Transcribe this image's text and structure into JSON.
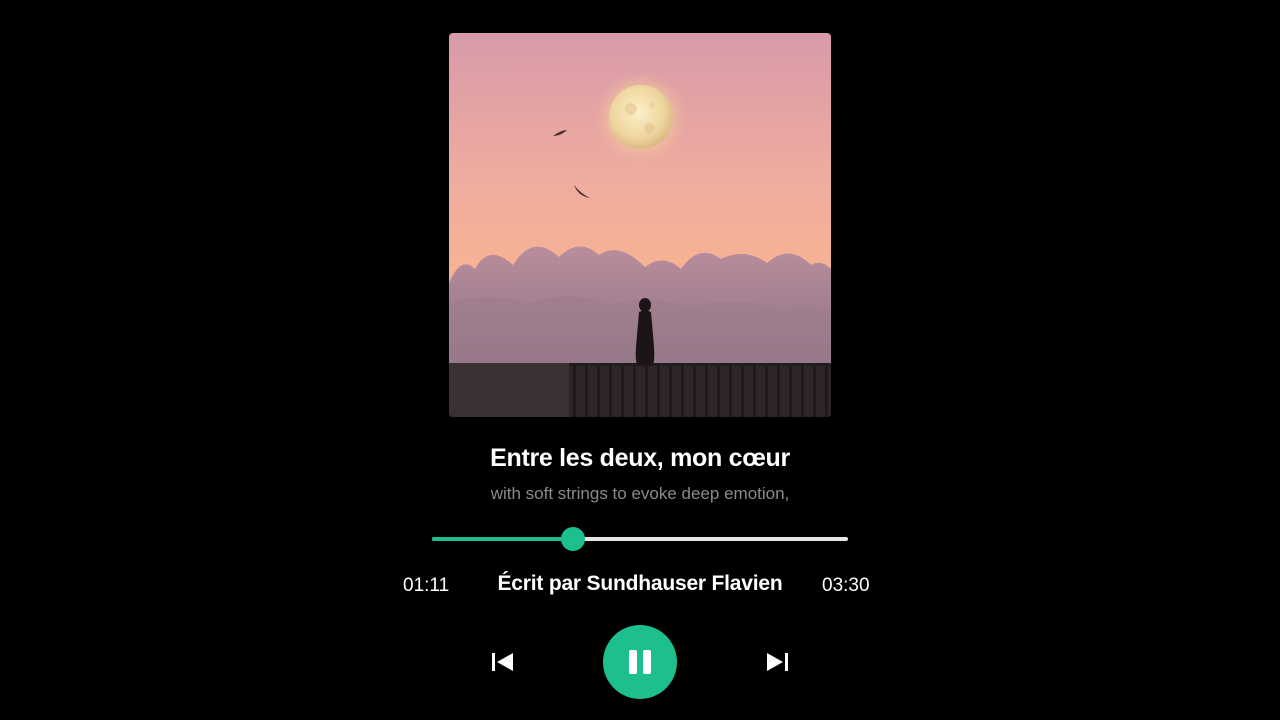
{
  "player": {
    "title": "Entre les deux, mon cœur",
    "subtitle": "with soft strings to evoke deep emotion,",
    "credit": "Écrit par Sundhauser Flavien",
    "elapsed": "01:11",
    "duration": "03:30",
    "progress_fraction": 0.338,
    "state": "playing"
  },
  "artwork": {
    "icon": "album-artwork"
  },
  "controls": {
    "previous_icon": "skip-previous-icon",
    "pause_icon": "pause-icon",
    "next_icon": "skip-next-icon"
  },
  "colors": {
    "accent": "#1dbf8f",
    "background": "#000000",
    "track": "#e6e6e6",
    "subtitle": "#8a8a8a"
  }
}
